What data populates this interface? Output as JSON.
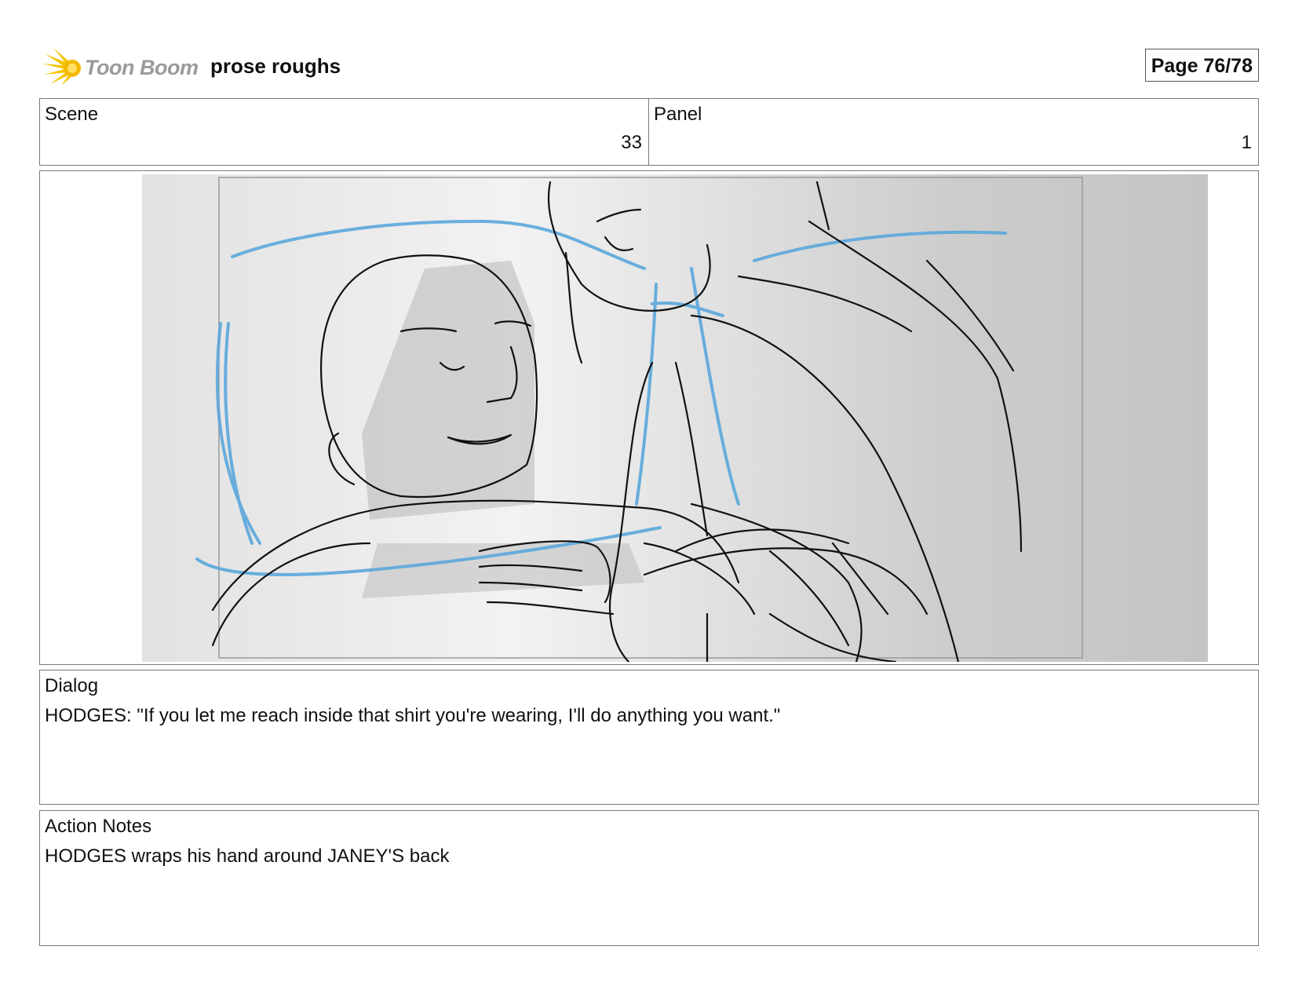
{
  "header": {
    "logo_text": "Toon Boom",
    "title": "prose roughs",
    "page": "Page 76/78"
  },
  "scene": {
    "label": "Scene",
    "value": "33"
  },
  "panel": {
    "label": "Panel",
    "value": "1"
  },
  "dialog": {
    "label": "Dialog",
    "text": "HODGES: \"If you let me reach inside that shirt you're wearing, I'll do anything you want.\""
  },
  "action_notes": {
    "label": "Action Notes",
    "text": "HODGES wraps his hand around JANEY'S back"
  },
  "colors": {
    "logo_burst": "#f5c400",
    "logo_text": "#9a9a9a",
    "sketch_blue": "#5aa7dc",
    "sketch_line": "#111111",
    "frame_bg": "#d2d2d2"
  }
}
